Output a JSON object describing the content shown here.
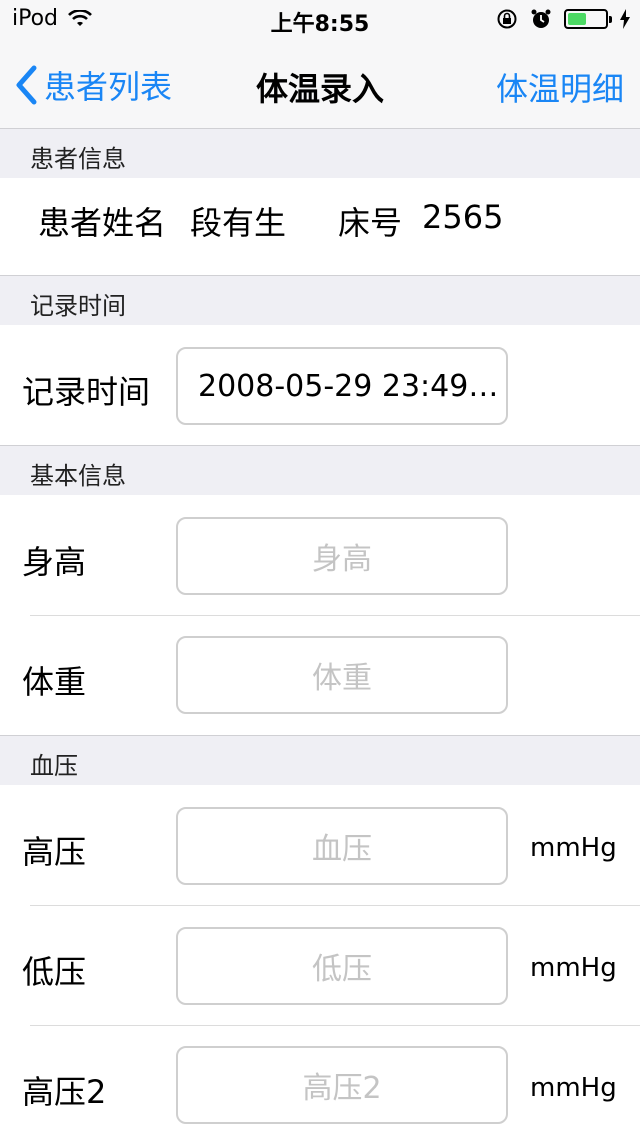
{
  "status_bar": {
    "carrier": "iPod",
    "time": "上午8:55"
  },
  "nav": {
    "back_label": "患者列表",
    "title": "体温录入",
    "right_label": "体温明细"
  },
  "sections": {
    "patient": "患者信息",
    "record_time": "记录时间",
    "basic": "基本信息",
    "blood_pressure": "血压"
  },
  "patient": {
    "name_label": "患者姓名",
    "name": "段有生",
    "bed_label": "床号",
    "bed": "2565"
  },
  "record_time": {
    "label": "记录时间",
    "value": "2008-05-29 23:49…"
  },
  "basic": {
    "height_label": "身高",
    "height_placeholder": "身高",
    "weight_label": "体重",
    "weight_placeholder": "体重"
  },
  "blood_pressure": {
    "high_label": "高压",
    "high_placeholder": "血压",
    "low_label": "低压",
    "low_placeholder": "低压",
    "high2_label": "高压2",
    "high2_placeholder": "高压2",
    "unit": "mmHg"
  },
  "colors": {
    "accent": "#1a86f5",
    "battery": "#4cd964",
    "section_bg": "#efeff4"
  },
  "battery_level": 0.45
}
